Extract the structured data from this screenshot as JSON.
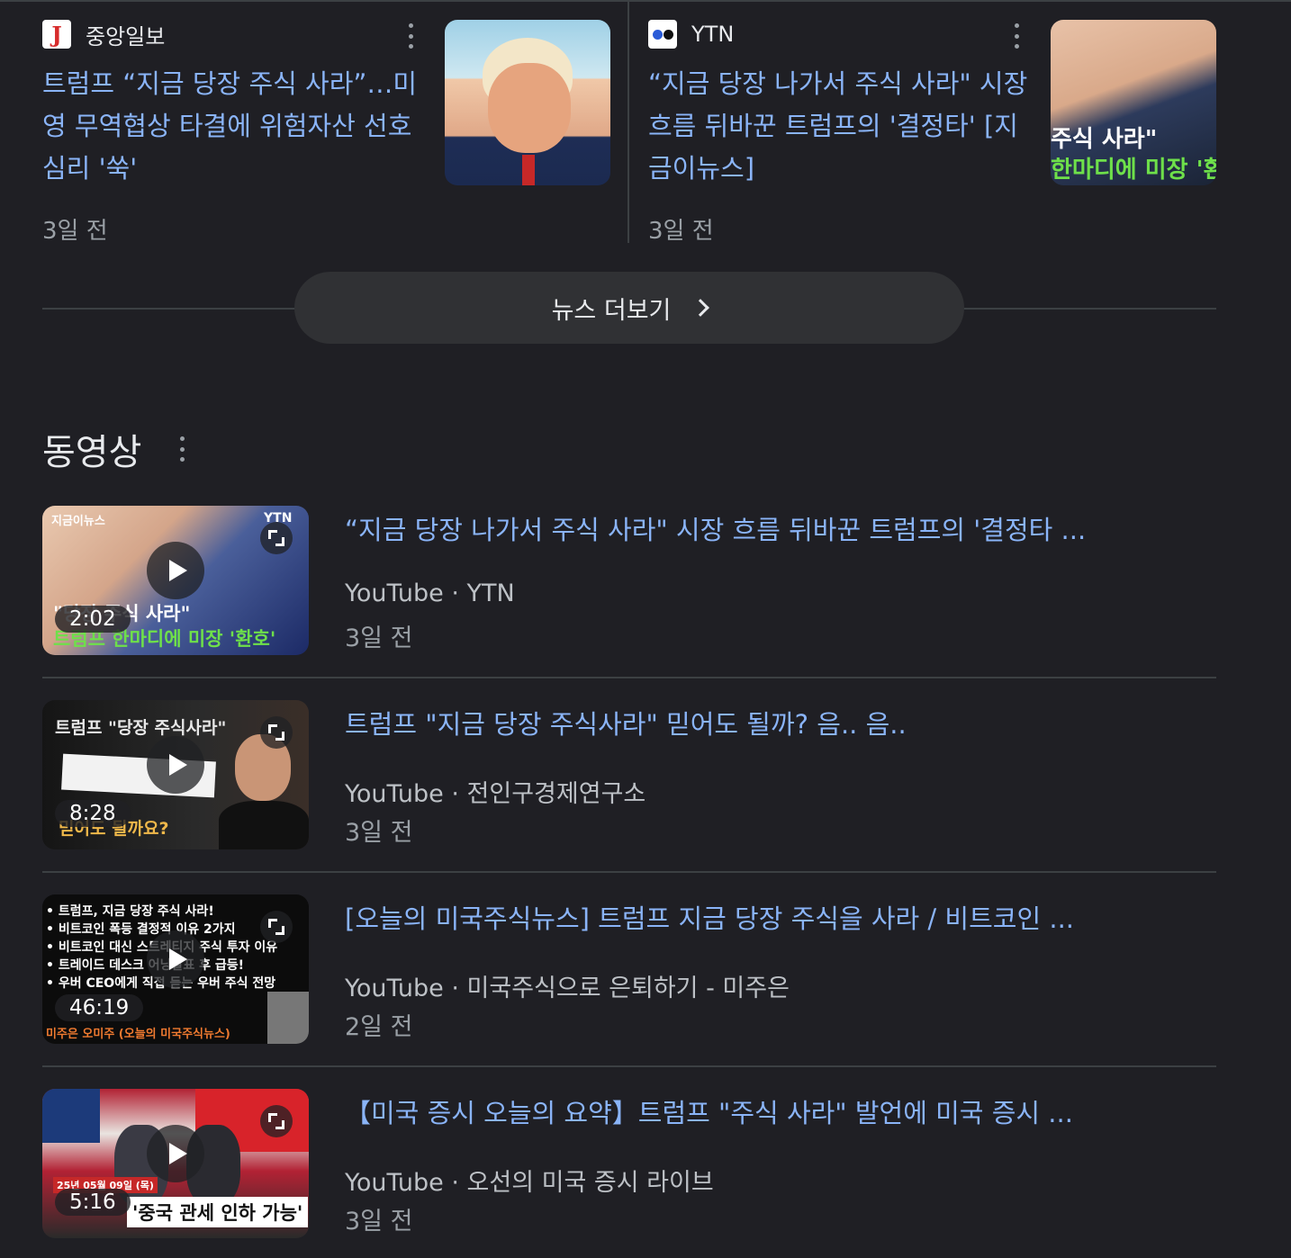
{
  "news": [
    {
      "source": "중앙일보",
      "title_lines": [
        "트럼프 “지금 당장 주식 사라”…미",
        "영 무역협상 타결에 위험자산 선호",
        "심리 '쑥'"
      ],
      "time": "3일 전"
    },
    {
      "source": "YTN",
      "title_lines": [
        "“지금 당장 나가서 주식 사라\" 시장",
        "흐름 뒤바꾼 트럼프의 '결정타' [지",
        "금이뉴스]"
      ],
      "time": "3일 전",
      "thumb_text": [
        "주식 사라\"",
        "한마디에 미장 '환"
      ]
    }
  ],
  "more_news": {
    "label": "뉴스 더보기"
  },
  "videos_section": {
    "title": "동영상",
    "items": [
      {
        "title": "“지금 당장 나가서 주식 사라\" 시장 흐름 뒤바꾼 트럼프의 '결정타 ...",
        "meta": "YouTube · YTN",
        "time": "3일 전",
        "duration": "2:02",
        "thumb_text": [
          "지금이뉴스",
          "YTN",
          "\"당장 주식 사라\"",
          "트럼프 한마디에 미장 '환호'"
        ]
      },
      {
        "title": "트럼프 \"지금 당장 주식사라\" 믿어도 될까? 음.. 음..",
        "meta": "YouTube · 전인구경제연구소",
        "time": "3일 전",
        "duration": "8:28",
        "thumb_text": [
          "트럼프 \"당장 주식사라\"",
          "믿어도 될까요?"
        ]
      },
      {
        "title": "[오늘의 미국주식뉴스] 트럼프 지금 당장 주식을 사라 / 비트코인 ...",
        "meta": "YouTube · 미국주식으로 은퇴하기 - 미주은",
        "time": "2일 전",
        "duration": "46:19",
        "thumb_text": [
          "• 트럼프, 지금 당장 주식 사라!",
          "• 비트코인 폭등 결정적 이유 2가지",
          "• 비트코인 대신 스트레티지 주식 투자 이유",
          "• 트레이드 데스크 어닝발표 후 급등!",
          "• 우버 CEO에게 직접 듣는 우버 주식 전망",
          "미주은 오미주 (오늘의 미국주식뉴스)"
        ]
      },
      {
        "title": "【미국 증시 오늘의 요약】트럼프 \"주식 사라\" 발언에 미국 증시 ...",
        "meta": "YouTube · 오선의 미국 증시 라이브",
        "time": "3일 전",
        "duration": "5:16",
        "thumb_text": [
          "25년 05월 09일 (목)",
          "'중국 관세 인하 가능'"
        ]
      }
    ]
  },
  "colors": {
    "background": "#1f1f24",
    "link": "#8ab4f8",
    "divider": "#3c4043",
    "button": "#303134"
  }
}
